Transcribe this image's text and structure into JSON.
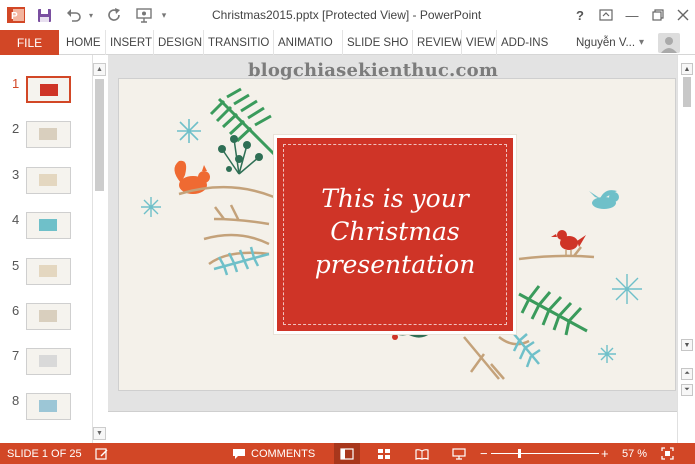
{
  "window": {
    "title": "Christmas2015.pptx [Protected View] - PowerPoint",
    "help_label": "?",
    "minimize_label": "—"
  },
  "ribbon": {
    "file_label": "FILE",
    "tabs": [
      "HOME",
      "INSERT",
      "DESIGN",
      "TRANSITIO",
      "ANIMATIO",
      "SLIDE SHO",
      "REVIEW",
      "VIEW",
      "ADD-INS"
    ],
    "user_name": "Nguyễn V...",
    "user_dropdown": "▾"
  },
  "thumbnails": {
    "numbers": [
      "1",
      "2",
      "3",
      "4",
      "5",
      "6",
      "7",
      "8"
    ],
    "active_index": 0
  },
  "slide": {
    "title": "This is your Christmas presentation",
    "watermark": "blogchiasekienthuc.com"
  },
  "statusbar": {
    "slide_counter": "SLIDE 1 OF 25",
    "comments_label": "COMMENTS",
    "zoom_minus": "−",
    "zoom_plus": "+",
    "zoom_percent": "57 %",
    "zoom_level": 0.57
  },
  "colors": {
    "accent": "#D24726",
    "slide_red": "#CF3427",
    "slide_bg": "#F4F1EA",
    "pine_green": "#3A9B5C",
    "teal": "#6FC0C9",
    "branch": "#C4A27A"
  },
  "icons": {
    "save": "save-icon",
    "undo": "undo-icon",
    "redo": "redo-icon",
    "presenter": "presenter-icon",
    "customize": "customize-qat-icon",
    "ribbon_options": "ribbon-display-icon",
    "restore": "restore-icon",
    "close": "close-icon"
  }
}
